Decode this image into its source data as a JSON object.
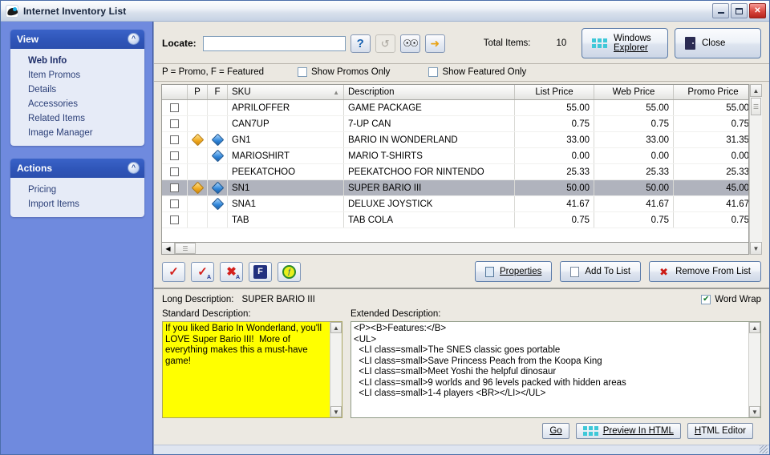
{
  "window": {
    "title": "Internet Inventory List",
    "icon": "app-globe-icon",
    "minimize": "–",
    "maximize": "□",
    "close": "✕"
  },
  "sidebar": {
    "panels": [
      {
        "title": "View",
        "collapse_icon": "chevron-up-icon",
        "items": [
          {
            "label": "Web Info",
            "active": true
          },
          {
            "label": "Item Promos",
            "active": false
          },
          {
            "label": "Details",
            "active": false
          },
          {
            "label": "Accessories",
            "active": false
          },
          {
            "label": "Related Items",
            "active": false
          },
          {
            "label": "Image Manager",
            "active": false
          }
        ]
      },
      {
        "title": "Actions",
        "collapse_icon": "chevron-up-icon",
        "items": [
          {
            "label": "Pricing",
            "active": false
          },
          {
            "label": "Import Items",
            "active": false
          }
        ]
      }
    ]
  },
  "toolbar": {
    "locate_label": "Locate:",
    "locate_value": "",
    "locate_placeholder": "",
    "help_icon": "question-mark-icon",
    "refresh_icon": "refresh-icon",
    "find_icon": "binoculars-icon",
    "goto_icon": "yellow-arrow-icon",
    "total_items_label": "Total Items:",
    "total_items_value": "10",
    "windows_explorer_line1": "Windows",
    "windows_explorer_line2": "Explorer",
    "windows_explorer_icon": "grid-squares-icon",
    "close_label": "Close",
    "close_icon": "exit-door-icon"
  },
  "legend": {
    "text": "P = Promo, F = Featured",
    "show_promos_label": "Show Promos Only",
    "show_promos_checked": false,
    "show_featured_label": "Show Featured Only",
    "show_featured_checked": false
  },
  "grid": {
    "columns": [
      "",
      "P",
      "F",
      "SKU",
      "Description",
      "List Price",
      "Web Price",
      "Promo Price"
    ],
    "sort_column": "SKU",
    "sort_icon": "sort-ascending-icon",
    "rows": [
      {
        "checked": false,
        "p": false,
        "f": false,
        "sku": "APRILOFFER",
        "description": "GAME PACKAGE",
        "list": "55.00",
        "web": "55.00",
        "promo": "55.00",
        "selected": false
      },
      {
        "checked": false,
        "p": false,
        "f": false,
        "sku": "CAN7UP",
        "description": "7-UP CAN",
        "list": "0.75",
        "web": "0.75",
        "promo": "0.75",
        "selected": false
      },
      {
        "checked": false,
        "p": true,
        "f": true,
        "sku": "GN1",
        "description": "BARIO IN WONDERLAND",
        "list": "33.00",
        "web": "33.00",
        "promo": "31.35",
        "selected": false
      },
      {
        "checked": false,
        "p": false,
        "f": true,
        "sku": "MARIOSHIRT",
        "description": "MARIO T-SHIRTS",
        "list": "0.00",
        "web": "0.00",
        "promo": "0.00",
        "selected": false
      },
      {
        "checked": false,
        "p": false,
        "f": false,
        "sku": "PEEKATCHOO",
        "description": "PEEKATCHOO FOR NINTENDO",
        "list": "25.33",
        "web": "25.33",
        "promo": "25.33",
        "selected": false
      },
      {
        "checked": false,
        "p": true,
        "f": true,
        "sku": "SN1",
        "description": "SUPER BARIO III",
        "list": "50.00",
        "web": "50.00",
        "promo": "45.00",
        "selected": true
      },
      {
        "checked": false,
        "p": false,
        "f": true,
        "sku": "SNA1",
        "description": "DELUXE JOYSTICK",
        "list": "41.67",
        "web": "41.67",
        "promo": "41.67",
        "selected": false
      },
      {
        "checked": false,
        "p": false,
        "f": false,
        "sku": "TAB",
        "description": "TAB COLA",
        "list": "0.75",
        "web": "0.75",
        "promo": "0.75",
        "selected": false
      }
    ]
  },
  "actionbar": {
    "check_all_icon": "red-check-icon",
    "check_all_a_icon": "red-check-a-icon",
    "uncheck_all_icon": "red-x-check-icon",
    "featured_icon": "f-badge-icon",
    "promo_icon": "promo-badge-icon",
    "properties_label": "Properties",
    "properties_underline": "P",
    "properties_icon": "clipboard-icon",
    "add_to_list_label": "Add To List",
    "add_to_list_icon": "document-icon",
    "remove_from_list_label": "Remove From List",
    "remove_from_list_icon": "red-x-document-icon"
  },
  "description": {
    "long_description_label": "Long Description:",
    "long_description_value": "SUPER BARIO III",
    "word_wrap_label": "Word Wrap",
    "word_wrap_checked": true,
    "standard_label": "Standard Description:",
    "standard_text": "If you liked Bario In Wonderland, you'll LOVE Super Bario III!  More of everything makes this a must-have game!",
    "extended_label": "Extended Description:",
    "extended_text": "<P><B>Features:</B>\n<UL>\n  <LI class=small>The SNES classic goes portable\n  <LI class=small>Save Princess Peach from the Koopa King\n  <LI class=small>Meet Yoshi the helpful dinosaur\n  <LI class=small>9 worlds and 96 levels packed with hidden areas\n  <LI class=small>1-4 players <BR></LI></UL>"
  },
  "bottombar": {
    "go_label": "Go",
    "go_underline": "G",
    "preview_label": "Preview In HTML",
    "preview_icon": "grid-squares-icon",
    "html_editor_label": "HTML Editor"
  },
  "colors": {
    "sidebar_bg": "#6f8ade",
    "panel_header": "#2f55b8",
    "selection_row": "#b0b3bd",
    "standard_desc_bg": "#ffff00",
    "promo_diamond": "#f0a81d",
    "featured_diamond": "#2f85d9"
  }
}
